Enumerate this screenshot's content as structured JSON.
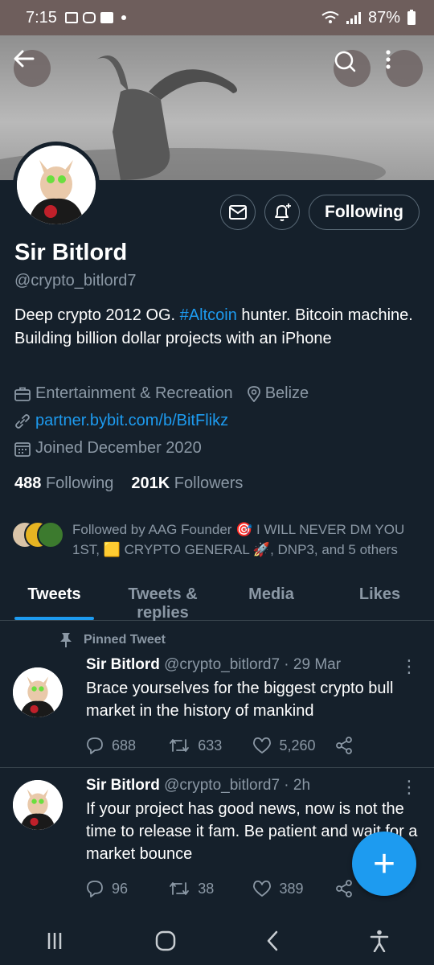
{
  "status_bar": {
    "time": "7:15",
    "battery": "87%"
  },
  "header": {
    "back_icon": "arrow-left-icon",
    "search_icon": "search-icon",
    "more_icon": "more-vertical-icon"
  },
  "profile": {
    "name": "Sir Bitlord",
    "handle": "@crypto_bitlord7",
    "bio_before": "Deep crypto 2012 OG. ",
    "bio_tag": "#Altcoin",
    "bio_after": " hunter. Bitcoin machine. Building billion dollar projects with an iPhone",
    "category": "Entertainment & Recreation",
    "location": "Belize",
    "website": "partner.bybit.com/b/BitFlikz",
    "joined": "Joined December 2020",
    "following_count": "488",
    "following_label": "Following",
    "followers_count": "201K",
    "followers_label": "Followers",
    "follow_button": "Following",
    "followed_by": "Followed by AAG Founder 🎯 I WILL NEVER DM YOU 1ST, 🟨 CRYPTO GENERAL 🚀, DNP3, and 5 others"
  },
  "tabs": [
    {
      "label": "Tweets",
      "active": true
    },
    {
      "label": "Tweets & replies",
      "active": false
    },
    {
      "label": "Media",
      "active": false
    },
    {
      "label": "Likes",
      "active": false
    }
  ],
  "tweets": [
    {
      "pinned_label": "Pinned Tweet",
      "name": "Sir Bitlord",
      "meta": " @crypto_bitlord7 · 29 Mar",
      "text": "Brace yourselves for the biggest crypto bull market in the history of mankind",
      "replies": "688",
      "retweets": "633",
      "likes": "5,260"
    },
    {
      "name": "Sir Bitlord",
      "meta": " @crypto_bitlord7 · 2h",
      "text": "If your project has good news, now is not the time to release it fam. Be patient and wait for a market bounce",
      "replies": "96",
      "retweets": "38",
      "likes": "389"
    }
  ],
  "fab": {
    "label": "+"
  },
  "colors": {
    "accent": "#1d9bf0",
    "background": "#15202b",
    "muted": "#8b98a5",
    "border": "#38444d"
  }
}
